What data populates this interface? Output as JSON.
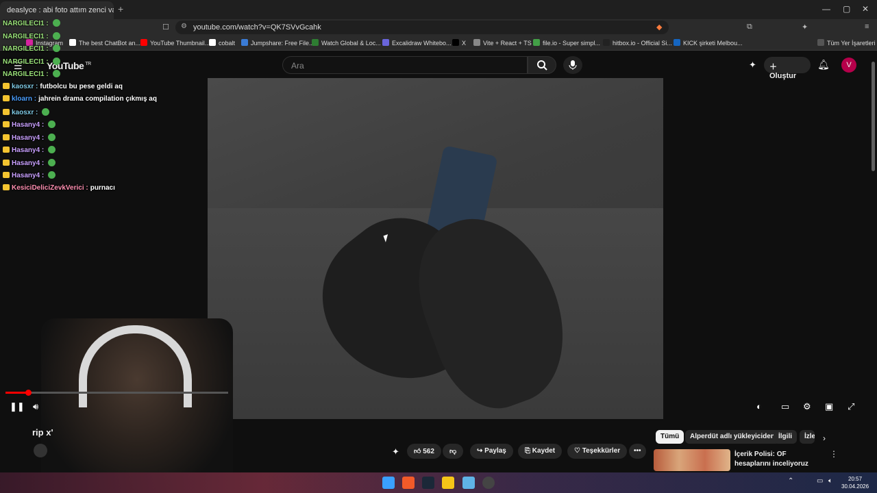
{
  "browser": {
    "tab_title": "deaslyce : abi foto attım zenci var",
    "new_tab": "+",
    "url": "youtube.com/watch?v=QK7SVvGcahk",
    "bookmarks": [
      {
        "label": "Instagram",
        "color": "#d6249f"
      },
      {
        "label": "The best ChatBot an...",
        "color": "#ffffff"
      },
      {
        "label": "YouTube Thumbnail...",
        "color": "#ff0000"
      },
      {
        "label": "cobalt",
        "color": "#ffffff"
      },
      {
        "label": "Jumpshare: Free File...",
        "color": "#3a7bd5"
      },
      {
        "label": "Watch Global & Loc...",
        "color": "#2e7d32"
      },
      {
        "label": "Excalidraw Whitebo...",
        "color": "#6965db"
      },
      {
        "label": "X",
        "color": "#000000"
      },
      {
        "label": "Vite + React + TS",
        "color": "#888888"
      },
      {
        "label": "file.io - Super simpl...",
        "color": "#43a047"
      },
      {
        "label": "hitbox.io - Official Si...",
        "color": "#222222"
      },
      {
        "label": "KICK şirketi Melbou...",
        "color": "#1565c0"
      }
    ],
    "all_bookmarks": "Tüm Yer İşaretleri"
  },
  "youtube": {
    "logo": "YouTube",
    "region": "TR",
    "search_placeholder": "Ara",
    "create_label": "Oluştur",
    "avatar_letter": "V",
    "video_title": "rip x'",
    "actions": {
      "likes": "562",
      "share": "Paylaş",
      "save": "Kaydet",
      "thanks": "Teşekkürler"
    },
    "chips": [
      "Tümü",
      "Alperdüt adlı yükleyiciden",
      "İlgili",
      "İzle"
    ],
    "recommendation_title": "İçerik Polisi: OF hesaplarını inceliyoruz"
  },
  "chat": [
    {
      "user": "NARGILECI1 :",
      "text": "",
      "color": "#9be37a",
      "emote": true
    },
    {
      "user": "NARGILECI1 :",
      "text": "",
      "color": "#9be37a",
      "emote": true
    },
    {
      "user": "NARGILECI1 :",
      "text": "",
      "color": "#9be37a",
      "emote": true
    },
    {
      "user": "NARGILECI1 :",
      "text": "",
      "color": "#9be37a",
      "emote": true
    },
    {
      "user": "NARGILECI1 :",
      "text": "",
      "color": "#9be37a",
      "emote": true
    },
    {
      "user": "kaosxr :",
      "text": "futbolcu bu pese geldi aq",
      "color": "#7ec8e3",
      "emote": false
    },
    {
      "user": "kloarn :",
      "text": "jahrein drama compilation çıkmış aq",
      "color": "#4a9eff",
      "emote": false
    },
    {
      "user": "kaosxr :",
      "text": "",
      "color": "#7ec8e3",
      "emote": true
    },
    {
      "user": "Hasany4 :",
      "text": "",
      "color": "#c9a0ff",
      "emote": true
    },
    {
      "user": "Hasany4 :",
      "text": "",
      "color": "#c9a0ff",
      "emote": true
    },
    {
      "user": "Hasany4 :",
      "text": "",
      "color": "#c9a0ff",
      "emote": true
    },
    {
      "user": "Hasany4 :",
      "text": "",
      "color": "#c9a0ff",
      "emote": true
    },
    {
      "user": "Hasany4 :",
      "text": "",
      "color": "#c9a0ff",
      "emote": true
    },
    {
      "user": "KesiciDeliciZevkVerici :",
      "text": "purnacı",
      "color": "#ff8fb1",
      "emote": false
    }
  ],
  "player": {
    "progress": 0.1
  },
  "taskbar": {
    "time": "20:57",
    "date": "30.04.2026"
  }
}
